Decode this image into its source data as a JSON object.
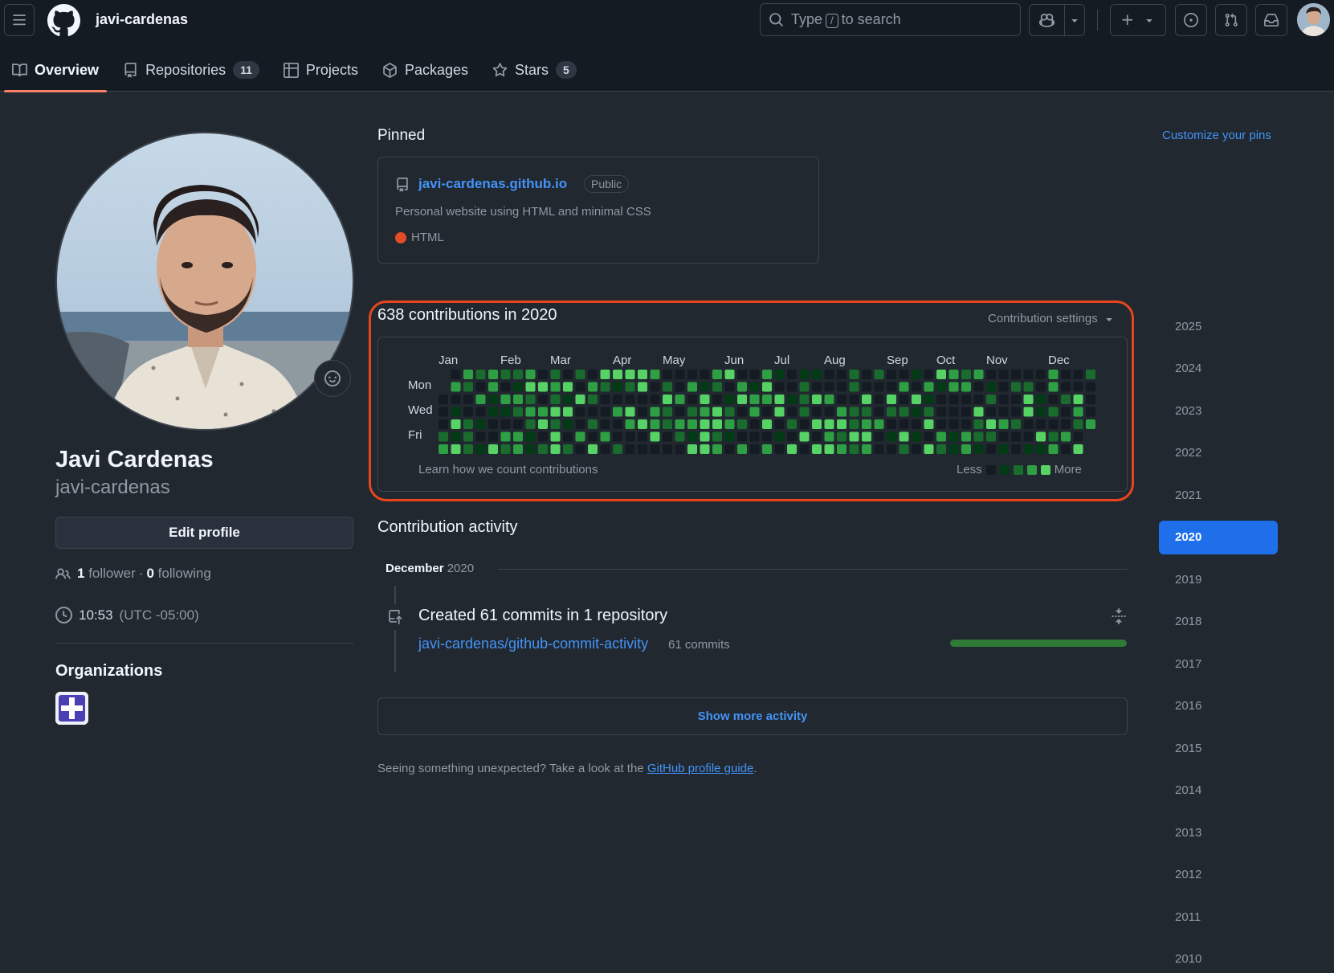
{
  "header": {
    "username": "javi-cardenas",
    "search": {
      "prefix": "Type",
      "key": "/",
      "suffix": "to search"
    }
  },
  "tabs": [
    {
      "label": "Overview",
      "icon": "book-icon",
      "active": true
    },
    {
      "label": "Repositories",
      "icon": "repo-icon",
      "count": "11"
    },
    {
      "label": "Projects",
      "icon": "table-icon"
    },
    {
      "label": "Packages",
      "icon": "package-icon"
    },
    {
      "label": "Stars",
      "icon": "star-icon",
      "count": "5"
    }
  ],
  "profile": {
    "name": "Javi Cardenas",
    "login": "javi-cardenas",
    "edit_label": "Edit profile",
    "followers": "1",
    "followers_label": "follower",
    "separator": "·",
    "following": "0",
    "following_label": "following",
    "time": "10:53",
    "timezone": "(UTC -05:00)",
    "organizations_title": "Organizations"
  },
  "pinned": {
    "title": "Pinned",
    "customize": "Customize your pins",
    "repo": {
      "name": "javi-cardenas.github.io",
      "visibility": "Public",
      "description": "Personal website using HTML and minimal CSS",
      "language": "HTML",
      "language_color": "#e34c26"
    }
  },
  "contributions": {
    "title": "638 contributions in 2020",
    "settings_label": "Contribution settings",
    "months": [
      "Jan",
      "Feb",
      "Mar",
      "Apr",
      "May",
      "Jun",
      "Jul",
      "Aug",
      "Sep",
      "Oct",
      "Nov",
      "Dec"
    ],
    "days": [
      "Mon",
      "Wed",
      "Fri"
    ],
    "learn": "Learn how we count contributions",
    "less": "Less",
    "more": "More",
    "level_colors": [
      "#151b23",
      "#033a16",
      "#196c2e",
      "#2ea043",
      "#56d364"
    ]
  },
  "activity": {
    "title": "Contribution activity",
    "month": "December",
    "year": "2020",
    "summary": "Created 61 commits in 1 repository",
    "repo": "javi-cardenas/github-commit-activity",
    "commits": "61 commits",
    "bar_fraction": 1.0,
    "show_more": "Show more activity"
  },
  "footer": {
    "text": "Seeing something unexpected? Take a look at the",
    "link": "GitHub profile guide",
    "end": "."
  },
  "years": [
    "2025",
    "2024",
    "2023",
    "2022",
    "2021",
    "2020",
    "2019",
    "2018",
    "2017",
    "2016",
    "2015",
    "2014",
    "2013",
    "2012",
    "2011",
    "2010"
  ],
  "selected_year": "2020"
}
